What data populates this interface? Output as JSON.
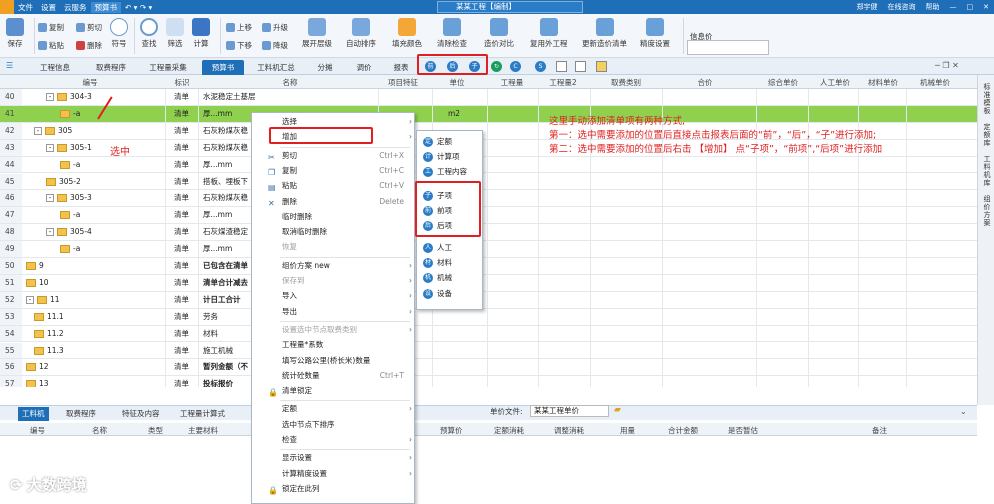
{
  "titlebar": {
    "menu": [
      "文件",
      "设置",
      "云服务",
      "预算书"
    ],
    "title": "某某工程【编制】",
    "right": [
      "郑宇健",
      "在线咨询",
      "帮助"
    ]
  },
  "ribbon": {
    "save": "保存",
    "copy": "复制",
    "paste": "粘贴",
    "cut": "剪切",
    "delete": "删除",
    "symbol": "符号",
    "find": "查找",
    "filter": "筛选",
    "calc": "计算",
    "up": "上移",
    "down": "下移",
    "upgrade": "升级",
    "downgrade": "降级",
    "expand": "展开层级",
    "autosort": "自动排序",
    "fillcolor": "填充颜色",
    "clearcheck": "清除检查",
    "pricecompare": "造价对比",
    "reuse": "复用外工程",
    "update": "更新造价清单",
    "precision": "精度设置",
    "info": "信息价"
  },
  "tabs": [
    "工程信息",
    "取费程序",
    "工程量采集",
    "预算书",
    "工料机汇总",
    "分摊",
    "调价",
    "报表"
  ],
  "grid": {
    "headers": [
      "编号",
      "标识",
      "名称",
      "项目特征",
      "单位",
      "工程量",
      "工程量2",
      "取费类别",
      "合价",
      "综合单价",
      "人工单价",
      "材料单价",
      "机械单价"
    ],
    "rows": [
      {
        "n": "40",
        "code": "304-3",
        "type": "清单",
        "name": "水泥稳定土基层",
        "unit": "",
        "lvl": 3,
        "tg": "-",
        "bold": false
      },
      {
        "n": "41",
        "code": "-a",
        "type": "清单",
        "name": "厚...mm",
        "unit": "m2",
        "lvl": 4,
        "tg": "",
        "bold": false
      },
      {
        "n": "42",
        "code": "305",
        "type": "清单",
        "name": "石灰粉煤灰稳",
        "unit": "",
        "lvl": 2,
        "tg": "-",
        "bold": false
      },
      {
        "n": "43",
        "code": "305-1",
        "type": "清单",
        "name": "石灰粉煤灰稳",
        "unit": "",
        "lvl": 3,
        "tg": "-",
        "bold": false
      },
      {
        "n": "44",
        "code": "-a",
        "type": "清单",
        "name": "厚...mm",
        "unit": "",
        "lvl": 4,
        "tg": "",
        "bold": false
      },
      {
        "n": "45",
        "code": "305-2",
        "type": "清单",
        "name": "搭板、埋板下",
        "unit": "",
        "lvl": 3,
        "tg": "",
        "bold": false
      },
      {
        "n": "46",
        "code": "305-3",
        "type": "清单",
        "name": "石灰粉煤灰稳",
        "unit": "",
        "lvl": 3,
        "tg": "-",
        "bold": false
      },
      {
        "n": "47",
        "code": "-a",
        "type": "清单",
        "name": "厚...mm",
        "unit": "",
        "lvl": 4,
        "tg": "",
        "bold": false
      },
      {
        "n": "48",
        "code": "305-4",
        "type": "清单",
        "name": "石灰煤渣稳定",
        "unit": "",
        "lvl": 3,
        "tg": "-",
        "bold": false
      },
      {
        "n": "49",
        "code": "-a",
        "type": "清单",
        "name": "厚...mm",
        "unit": "",
        "lvl": 4,
        "tg": "",
        "bold": false
      },
      {
        "n": "50",
        "code": "9",
        "type": "清单",
        "name": "已包含在清单",
        "unit": "",
        "lvl": 1,
        "tg": "",
        "bold": true
      },
      {
        "n": "51",
        "code": "10",
        "type": "清单",
        "name": "清单合计减去",
        "unit": "",
        "lvl": 1,
        "tg": "",
        "bold": true
      },
      {
        "n": "52",
        "code": "11",
        "type": "清单",
        "name": "计日工合计",
        "unit": "",
        "lvl": 1,
        "tg": "-",
        "bold": true
      },
      {
        "n": "53",
        "code": "11.1",
        "type": "清单",
        "name": "劳务",
        "unit": "",
        "lvl": 2,
        "tg": "",
        "bold": false
      },
      {
        "n": "54",
        "code": "11.2",
        "type": "清单",
        "name": "材料",
        "unit": "",
        "lvl": 2,
        "tg": "",
        "bold": false
      },
      {
        "n": "55",
        "code": "11.3",
        "type": "清单",
        "name": "施工机械",
        "unit": "",
        "lvl": 2,
        "tg": "",
        "bold": false
      },
      {
        "n": "56",
        "code": "12",
        "type": "清单",
        "name": "暂列金额（不",
        "unit": "",
        "lvl": 1,
        "tg": "",
        "bold": true
      },
      {
        "n": "57",
        "code": "13",
        "type": "清单",
        "name": "投标报价",
        "unit": "",
        "lvl": 1,
        "tg": "",
        "bold": true
      }
    ]
  },
  "sidebar": [
    "标准模板",
    "定额库",
    "工料机库",
    "组价方案"
  ],
  "bottom": {
    "tabs": [
      "工料机",
      "取费程序",
      "特征及内容",
      "工程量计算式"
    ],
    "unitfile_label": "单价文件:",
    "unitfile_value": "某某工程单价",
    "headers": [
      "编号",
      "名称",
      "类型",
      "主要材料",
      "预算价",
      "定额消耗",
      "调整消耗",
      "用量",
      "合计金额",
      "是否暂估",
      "备注"
    ]
  },
  "context": {
    "items": [
      {
        "label": "选择",
        "sc": "",
        "ar": true,
        "dis": false,
        "icon": ""
      },
      {
        "label": "增加",
        "sc": "",
        "ar": true,
        "dis": false,
        "icon": ""
      },
      {
        "label": "剪切",
        "sc": "Ctrl+X",
        "ar": false,
        "dis": false,
        "icon": "✂"
      },
      {
        "label": "复制",
        "sc": "Ctrl+C",
        "ar": false,
        "dis": false,
        "icon": "❐"
      },
      {
        "label": "粘贴",
        "sc": "Ctrl+V",
        "ar": false,
        "dis": false,
        "icon": "▤"
      },
      {
        "label": "删除",
        "sc": "Delete",
        "ar": false,
        "dis": false,
        "icon": "✕"
      },
      {
        "label": "临时删除",
        "sc": "",
        "ar": false,
        "dis": false,
        "icon": ""
      },
      {
        "label": "取消临时删除",
        "sc": "",
        "ar": false,
        "dis": false,
        "icon": ""
      },
      {
        "label": "恢复",
        "sc": "",
        "ar": false,
        "dis": true,
        "icon": ""
      },
      {
        "label": "组价方案 new",
        "sc": "",
        "ar": true,
        "dis": false,
        "icon": ""
      },
      {
        "label": "保存到",
        "sc": "",
        "ar": true,
        "dis": true,
        "icon": ""
      },
      {
        "label": "导入",
        "sc": "",
        "ar": true,
        "dis": false,
        "icon": ""
      },
      {
        "label": "导出",
        "sc": "",
        "ar": true,
        "dis": false,
        "icon": ""
      },
      {
        "label": "设置选中节点取费类别",
        "sc": "",
        "ar": true,
        "dis": true,
        "icon": ""
      },
      {
        "label": "工程量*系数",
        "sc": "",
        "ar": false,
        "dis": false,
        "icon": ""
      },
      {
        "label": "填写公路公里(桥长米)数量",
        "sc": "",
        "ar": false,
        "dis": false,
        "icon": ""
      },
      {
        "label": "统计砼数量",
        "sc": "Ctrl+T",
        "ar": false,
        "dis": false,
        "icon": ""
      },
      {
        "label": "清单锁定",
        "sc": "",
        "ar": false,
        "dis": false,
        "icon": "🔒"
      },
      {
        "label": "定额",
        "sc": "",
        "ar": true,
        "dis": false,
        "icon": ""
      },
      {
        "label": "选中节点下排序",
        "sc": "",
        "ar": false,
        "dis": false,
        "icon": ""
      },
      {
        "label": "检查",
        "sc": "",
        "ar": true,
        "dis": false,
        "icon": ""
      },
      {
        "label": "显示设置",
        "sc": "",
        "ar": true,
        "dis": false,
        "icon": ""
      },
      {
        "label": "计算精度设置",
        "sc": "",
        "ar": true,
        "dis": false,
        "icon": ""
      },
      {
        "label": "锁定在此列",
        "sc": "",
        "ar": false,
        "dis": false,
        "icon": "🔒"
      }
    ]
  },
  "submenu": {
    "items": [
      "定额",
      "计算项",
      "工程内容",
      "子项",
      "前项",
      "后项",
      "人工",
      "材料",
      "机械",
      "设备"
    ]
  },
  "annotation": {
    "selected": "选中",
    "line1": "这里手动添加清单项有两种方式,",
    "line2": "第一：选中需要添加的位置后直接点击报表后面的“前”，“后”，“子”进行添加;",
    "line3": "第二：选中需要添加的位置后右击 【增加】 点“子项”，“前项”,“后项”进行添加"
  },
  "watermark": "大数跨境",
  "colors": {
    "accent": "#1f6fb8",
    "selected_row": "#8fd14f",
    "annotation": "#e02020"
  }
}
